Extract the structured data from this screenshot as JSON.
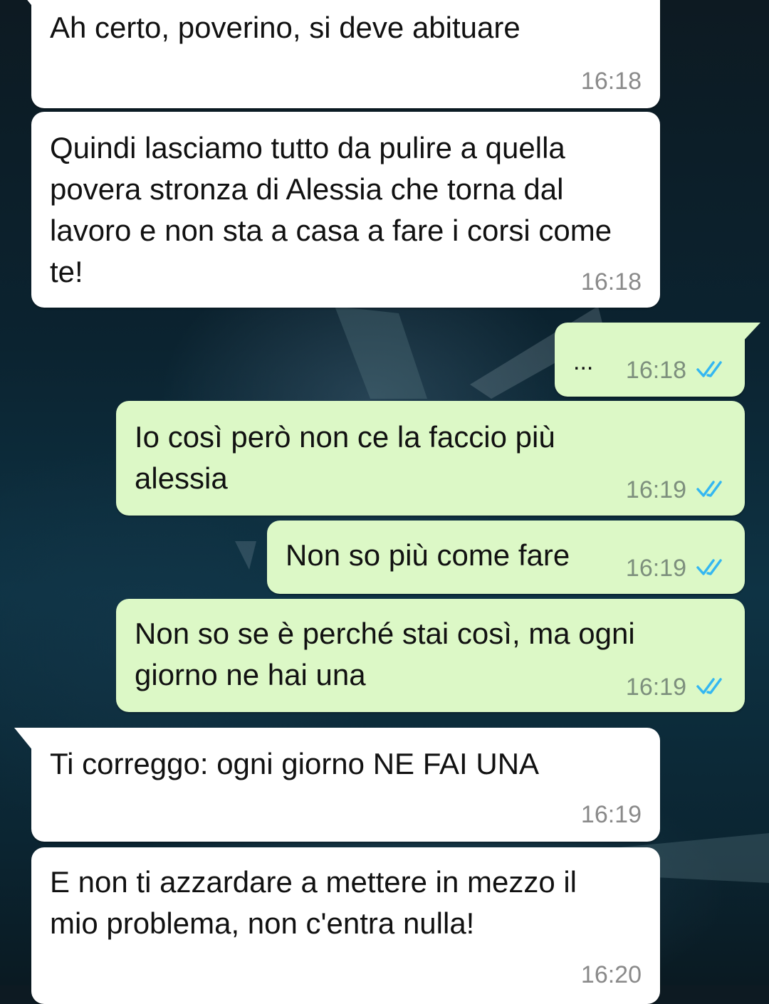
{
  "conversation": {
    "messages": [
      {
        "direction": "in",
        "text": "Ah certo, poverino, si deve abituare",
        "time": "16:18"
      },
      {
        "direction": "in",
        "text": "Quindi lasciamo tutto da pulire a quella povera stronza di Alessia che torna dal lavoro e non sta a casa a fare i corsi come te!",
        "time": "16:18"
      },
      {
        "direction": "out",
        "text": "...",
        "time": "16:18",
        "status": "read"
      },
      {
        "direction": "out",
        "text": "Io così però non ce la faccio più alessia",
        "time": "16:19",
        "status": "read"
      },
      {
        "direction": "out",
        "text": "Non so più come fare",
        "time": "16:19",
        "status": "read"
      },
      {
        "direction": "out",
        "text": "Non so se è perché stai così, ma ogni giorno ne hai una",
        "time": "16:19",
        "status": "read"
      },
      {
        "direction": "in",
        "text": "Ti correggo: ogni giorno NE FAI UNA",
        "time": "16:19"
      },
      {
        "direction": "in",
        "text": "E non ti azzardare a mettere in mezzo il mio problema, non c'entra nulla!",
        "time": "16:20"
      }
    ]
  },
  "icons": {
    "read_receipt": "double-check-icon"
  },
  "colors": {
    "incoming_bubble": "#ffffff",
    "outgoing_bubble": "#dcf8c6",
    "read_ticks": "#34b7f1"
  }
}
